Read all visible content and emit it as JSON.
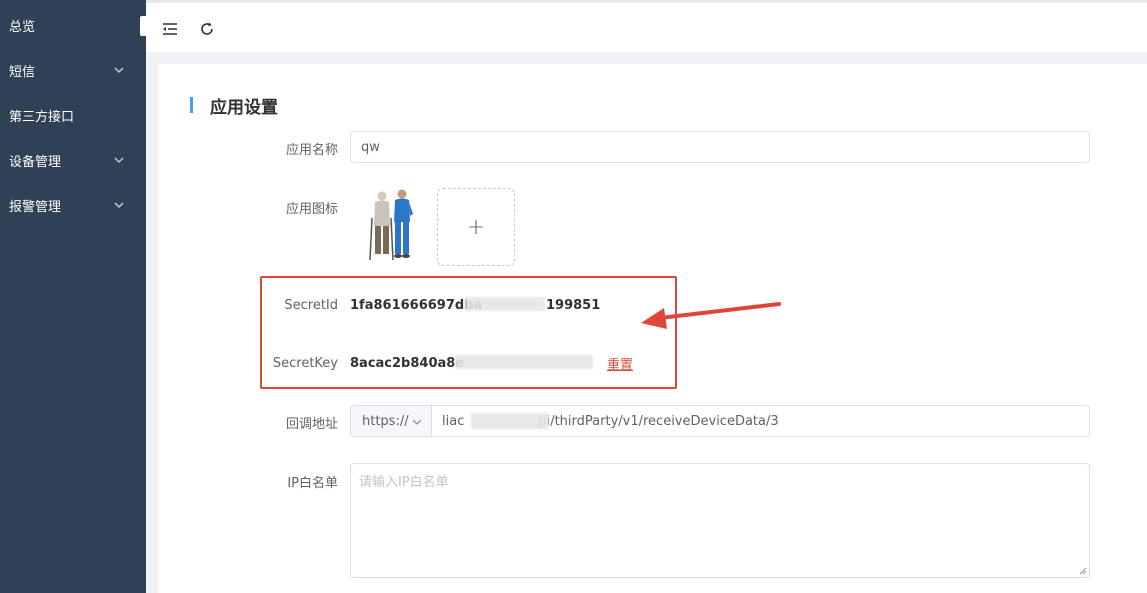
{
  "sidebar": {
    "items": [
      {
        "label": "总览",
        "has_children": false
      },
      {
        "label": "短信",
        "has_children": true
      },
      {
        "label": "第三方接口",
        "has_children": false
      },
      {
        "label": "设备管理",
        "has_children": true
      },
      {
        "label": "报警管理",
        "has_children": true
      }
    ]
  },
  "topbar": {
    "icons": [
      "menu-fold-icon",
      "refresh-icon"
    ]
  },
  "section": {
    "title": "应用设置"
  },
  "form": {
    "app_name_label": "应用名称",
    "app_name_value": "qw",
    "app_icon_label": "应用图标",
    "upload_plus": "+",
    "secret_id_label": "SecretId",
    "secret_id_value": "1fa861666697dba",
    "secret_id_tail": "199851",
    "secret_key_label": "SecretKey",
    "secret_key_value": "8acac2b840a8e",
    "reset_label": "重置",
    "callback_label": "回调地址",
    "protocol_value": "https://",
    "callback_prefix": "liac",
    "callback_suffix": "pi/thirdParty/v1/receiveDeviceData/3",
    "ip_whitelist_label": "IP白名单",
    "ip_whitelist_placeholder": "请输入IP白名单"
  },
  "colors": {
    "sidebar_bg": "#304156",
    "accent": "#409eff",
    "annotation_red": "#e0453a"
  }
}
